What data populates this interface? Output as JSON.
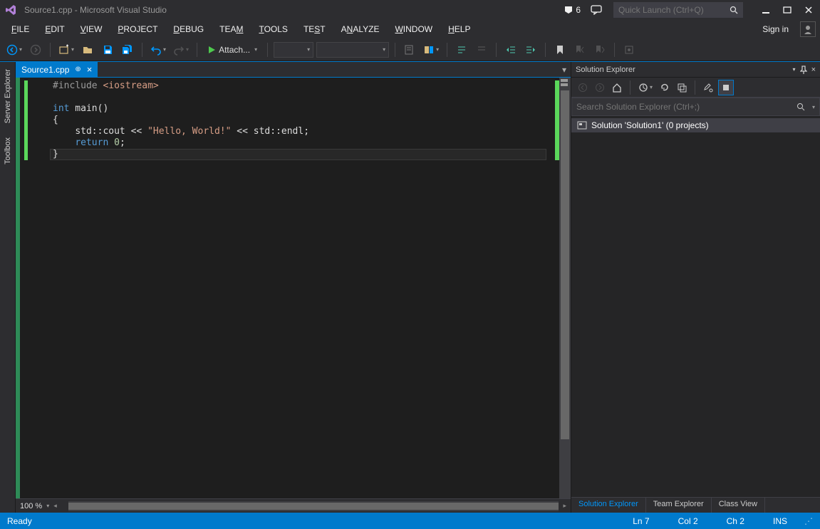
{
  "title": "Source1.cpp - Microsoft Visual Studio",
  "notif_count": "6",
  "quick_launch_placeholder": "Quick Launch (Ctrl+Q)",
  "menus": [
    "FILE",
    "EDIT",
    "VIEW",
    "PROJECT",
    "DEBUG",
    "TEAM",
    "TOOLS",
    "TEST",
    "ANALYZE",
    "WINDOW",
    "HELP"
  ],
  "signin": "Sign in",
  "attach_label": "Attach...",
  "tab": {
    "name": "Source1.cpp"
  },
  "code_lines": [
    {
      "indent": 0,
      "tokens": [
        {
          "cls": "tok-pp",
          "t": "#include "
        },
        {
          "cls": "tok-str",
          "t": "<iostream>"
        }
      ]
    },
    {
      "indent": 0,
      "tokens": []
    },
    {
      "indent": 0,
      "outline": true,
      "tokens": [
        {
          "cls": "tok-kw",
          "t": "int"
        },
        {
          "cls": "tok-plain",
          "t": " main()"
        }
      ]
    },
    {
      "indent": 0,
      "tokens": [
        {
          "cls": "tok-plain",
          "t": "{"
        }
      ]
    },
    {
      "indent": 1,
      "tokens": [
        {
          "cls": "tok-plain",
          "t": "std::cout << "
        },
        {
          "cls": "tok-str",
          "t": "\"Hello, World!\""
        },
        {
          "cls": "tok-plain",
          "t": " << std::endl;"
        }
      ]
    },
    {
      "indent": 1,
      "tokens": [
        {
          "cls": "tok-kw",
          "t": "return"
        },
        {
          "cls": "tok-plain",
          "t": " "
        },
        {
          "cls": "tok-num",
          "t": "0"
        },
        {
          "cls": "tok-plain",
          "t": ";"
        }
      ]
    },
    {
      "indent": 0,
      "current": true,
      "tokens": [
        {
          "cls": "tok-plain",
          "t": "}"
        }
      ]
    }
  ],
  "zoom": "100 %",
  "solution_panel": {
    "title": "Solution Explorer",
    "search_placeholder": "Search Solution Explorer (Ctrl+;)",
    "root": "Solution 'Solution1' (0 projects)",
    "tabs": [
      "Solution Explorer",
      "Team Explorer",
      "Class View"
    ]
  },
  "status": {
    "ready": "Ready",
    "ln": "Ln 7",
    "col": "Col 2",
    "ch": "Ch 2",
    "ins": "INS"
  },
  "left_rail": [
    "Server Explorer",
    "Toolbox"
  ]
}
